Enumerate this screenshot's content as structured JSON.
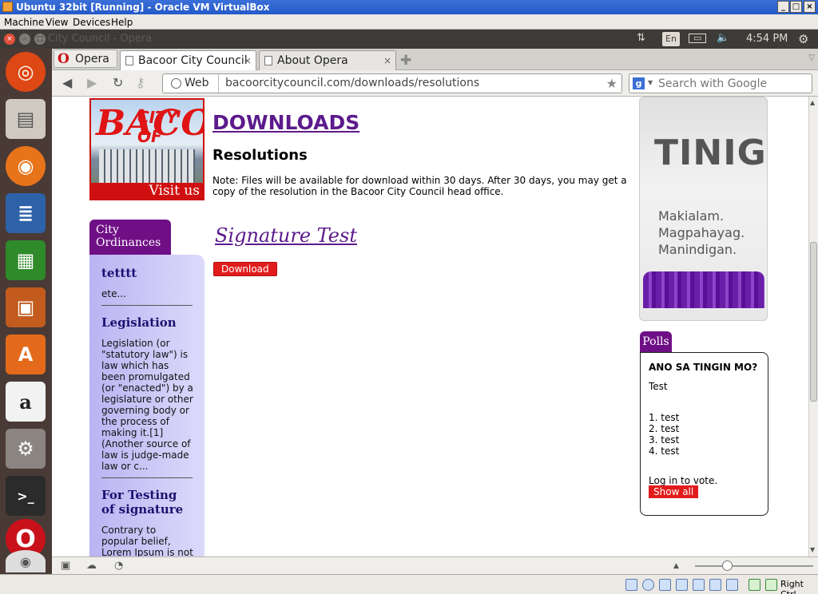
{
  "vbox": {
    "title": "Ubuntu 32bit [Running] - Oracle VM VirtualBox",
    "menu": [
      "Machine",
      "View",
      "Devices",
      "Help"
    ],
    "host_key": "Right Ctrl"
  },
  "panel": {
    "window_title": "City Council - Opera",
    "keyboard_layout": "En",
    "time": "4:54 PM"
  },
  "launcher": {
    "items": [
      "ubuntu-dash",
      "files",
      "firefox",
      "writer",
      "calc",
      "impress",
      "software-center",
      "amazon",
      "system-settings",
      "terminal",
      "opera",
      "dvd"
    ]
  },
  "browser": {
    "menu_label": "Opera",
    "tabs": [
      {
        "label": "Bacoor City Council",
        "active": true
      },
      {
        "label": "About Opera",
        "active": false
      }
    ],
    "address": {
      "badge": "Web",
      "url": "bacoorcitycouncil.com/downloads/resolutions"
    },
    "search": {
      "placeholder": "Search with Google"
    }
  },
  "page": {
    "logo": {
      "line1": "CITY OF",
      "line2": "BACOOR",
      "visit": "Visit us"
    },
    "heading": "DOWNLOADS",
    "subheading": "Resolutions",
    "note": "Note: Files will be available for download within 30 days. After 30 days, you may get a copy of the resolution in the Bacoor City Council head office.",
    "file": {
      "title": "Signature Test",
      "button": "Download"
    },
    "ordinances": {
      "tab": "City Ordinances",
      "items": [
        {
          "title": "tetttt",
          "excerpt": "ete..."
        },
        {
          "title": "Legislation",
          "excerpt": "Legislation (or \"statutory law\") is law which has been promulgated (or \"enacted\") by a legislature or other governing body or the process of making it.[1] (Another source of law is judge-made law or c..."
        },
        {
          "title": "For Testing of signature",
          "excerpt": "Contrary to popular belief, Lorem Ipsum is not simply random"
        }
      ]
    },
    "banner": {
      "title": "TINIG",
      "tagline": [
        "Makialam.",
        "Magpahayag.",
        "Manindigan."
      ]
    },
    "polls": {
      "tab": "Polls",
      "question": "ANO SA TINGIN MO?",
      "text": "Test",
      "options": [
        "1. test",
        "2. test",
        "3. test",
        "4. test"
      ],
      "login": "Log in to vote.",
      "show_all": "Show all"
    }
  },
  "colors": {
    "accent_purple": "#6f0f86",
    "button_red": "#e21c1c",
    "link_purple": "#5c1a8c"
  }
}
